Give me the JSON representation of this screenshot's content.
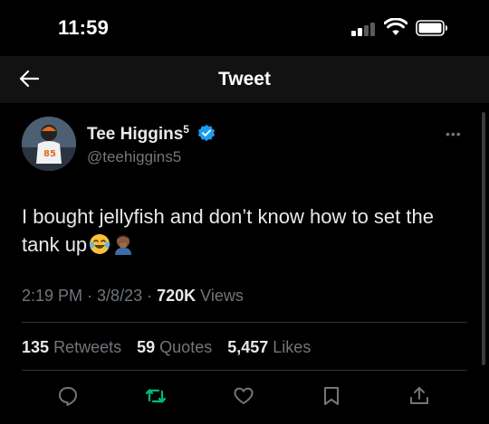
{
  "status_bar": {
    "time": "11:59",
    "icons": [
      "cellular-signal-icon",
      "wifi-icon",
      "battery-icon"
    ]
  },
  "nav": {
    "title": "Tweet",
    "back_icon": "arrow-left-icon"
  },
  "tweet": {
    "author": {
      "display_name": "Tee Higgins",
      "name_superscript": "5",
      "handle": "@teehiggins5",
      "verified": true
    },
    "text": "I bought jellyfish and don’t know how to set the tank up",
    "emojis": [
      "face-with-tears-of-joy-emoji",
      "man-facepalming-emoji"
    ],
    "time": "2:19 PM",
    "date": "3/8/23",
    "views_count": "720K",
    "views_label": "Views",
    "retweets_count": "135",
    "retweets_label": "Retweets",
    "quotes_count": "59",
    "quotes_label": "Quotes",
    "likes_count": "5,457",
    "likes_label": "Likes"
  },
  "actions": [
    "reply-icon",
    "retweet-icon",
    "like-icon",
    "bookmark-icon",
    "share-icon"
  ],
  "colors": {
    "background": "#000000",
    "text": "#e7e9ea",
    "secondary": "#71767b",
    "verified": "#1d9bf0",
    "retweet_green": "#00ba7c"
  }
}
